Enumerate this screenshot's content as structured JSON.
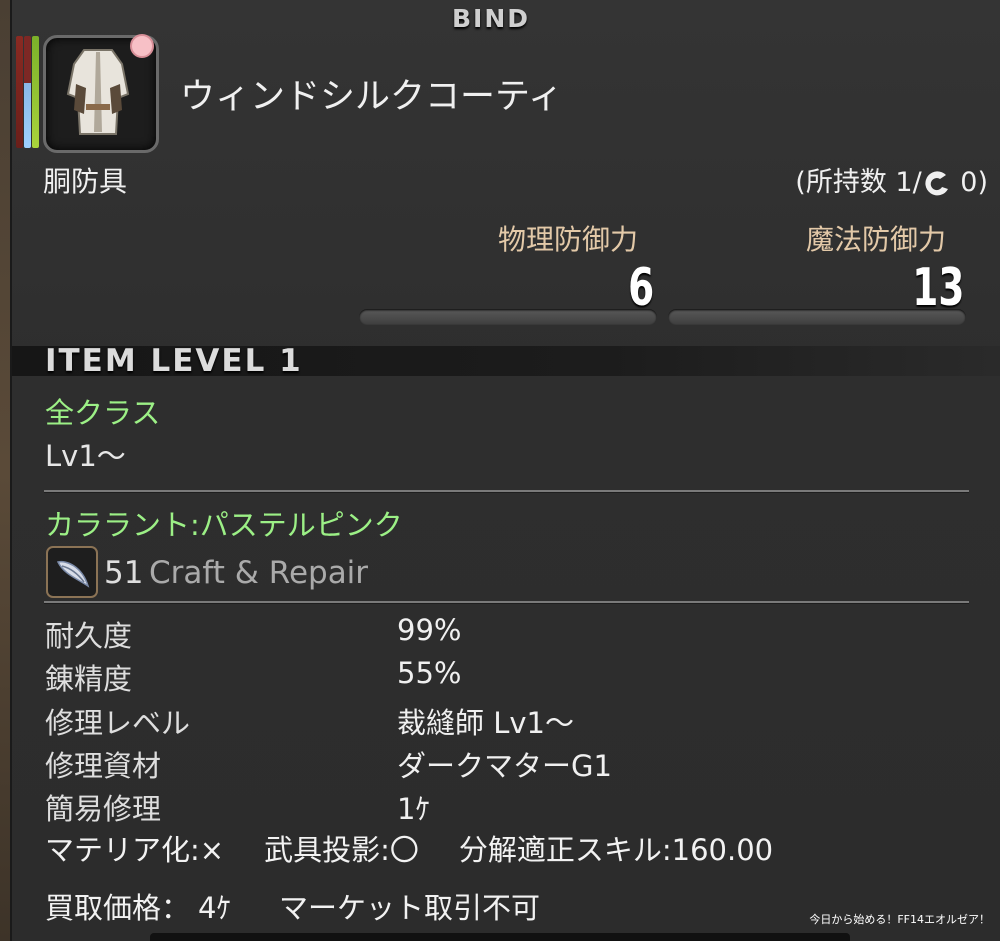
{
  "header": {
    "bind_label": "BIND"
  },
  "item": {
    "name": "ウィンドシルクコーティ",
    "category": "胴防具",
    "owned": "(所持数 1/",
    "owned_hq": " 0)",
    "icon": "coat-icon"
  },
  "stats": {
    "physical_label": "物理防御力",
    "physical_value": "6",
    "magic_label": "魔法防御力",
    "magic_value": "13"
  },
  "item_level": "ITEM LEVEL 1",
  "requirements": {
    "class": "全クラス",
    "level": "Lv1～"
  },
  "dye": "カララント:パステルピンク",
  "crafting": {
    "level": "51",
    "label": "Craft & Repair",
    "icon": "needle-icon"
  },
  "details": [
    {
      "label": "耐久度",
      "value": "99%"
    },
    {
      "label": "錬精度",
      "value": "55%"
    },
    {
      "label": "修理レベル",
      "value": "裁縫師 Lv1～"
    },
    {
      "label": "修理資材",
      "value": "ダークマターG1"
    },
    {
      "label": "簡易修理",
      "value": "1ｹ"
    }
  ],
  "flags": {
    "materia": "マテリア化:×",
    "glamour": "武具投影:〇",
    "desynth": "分解適正スキル:160.00"
  },
  "bottom": {
    "sell_label": "買取価格：",
    "sell_value": "4ｹ",
    "market": "マーケット取引不可"
  },
  "watermark": "今日から始める！FF14エオルゼア！",
  "colors": {
    "green_text": "#9cf086",
    "stat_label": "#e3c9a8"
  }
}
